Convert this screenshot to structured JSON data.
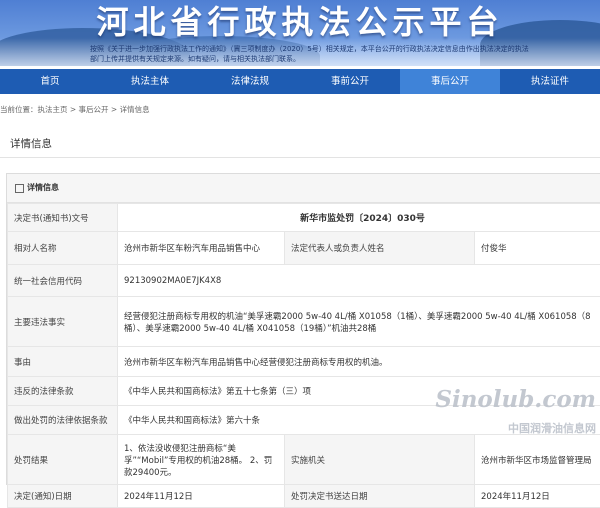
{
  "banner": {
    "title": "河北省行政执法公示平台",
    "notice": "按照《关于进一步加强行政执法工作的通知》（冀三项制度办（2020）5号）相关规定，本平台公开的行政执法决定信息由作出执法决定的执法部门上传并提供有关规定来源。如有疑问，请与相关执法部门联系。"
  },
  "nav": {
    "items": [
      {
        "label": "首页",
        "active": false
      },
      {
        "label": "执法主体",
        "active": false
      },
      {
        "label": "法律法规",
        "active": false
      },
      {
        "label": "事前公开",
        "active": false
      },
      {
        "label": "事后公开",
        "active": true
      },
      {
        "label": "执法证件",
        "active": false
      }
    ]
  },
  "breadcrumb": "当前位置：执法主页 > 事后公开 > 详情信息",
  "section_title": "详情信息",
  "panel_title": "详情信息",
  "rows": {
    "doc_number_label": "决定书(通知书)文号",
    "doc_number_value": "新华市监处罚〔2024〕030号",
    "party_label": "相对人名称",
    "party_value": "沧州市新华区车粉汽车用品销售中心",
    "legal_rep_label": "法定代表人或负责人姓名",
    "legal_rep_value": "付俊华",
    "credit_code_label": "统一社会信用代码",
    "credit_code_value": "92130902MA0E7JK4X8",
    "facts_label": "主要违法事实",
    "facts_value": "经营侵犯注册商标专用权的机油“美孚速霸2000 5w-40 4L/桶 X01058（1桶）、美孚速霸2000 5w-40 4L/桶 X061058（8桶）、美孚速霸2000 5w-40 4L/桶 X041058（19桶）”机油共28桶",
    "cause_label": "事由",
    "cause_value": "沧州市新华区车粉汽车用品销售中心经营侵犯注册商标专用权的机油。",
    "violated_law_label": "违反的法律条款",
    "violated_law_value": "《中华人民共和国商标法》第五十七条第（三）项",
    "penalty_basis_label": "做出处罚的法律依据条款",
    "penalty_basis_value": "《中华人民共和国商标法》第六十条",
    "result_label": "处罚结果",
    "result_value": "1、依法没收侵犯注册商标“美孚”“Mobil”专用权的机油28桶。 2、罚款29400元。",
    "agency_label": "实施机关",
    "agency_value": "沧州市新华区市场监督管理局",
    "decision_date_label": "决定(通知)日期",
    "decision_date_value": "2024年11月12日",
    "delivery_date_label": "处罚决定书送达日期",
    "delivery_date_value": "2024年11月12日"
  },
  "watermark": {
    "logo": "Sinolub.com",
    "line": "中国润滑油信息网"
  }
}
